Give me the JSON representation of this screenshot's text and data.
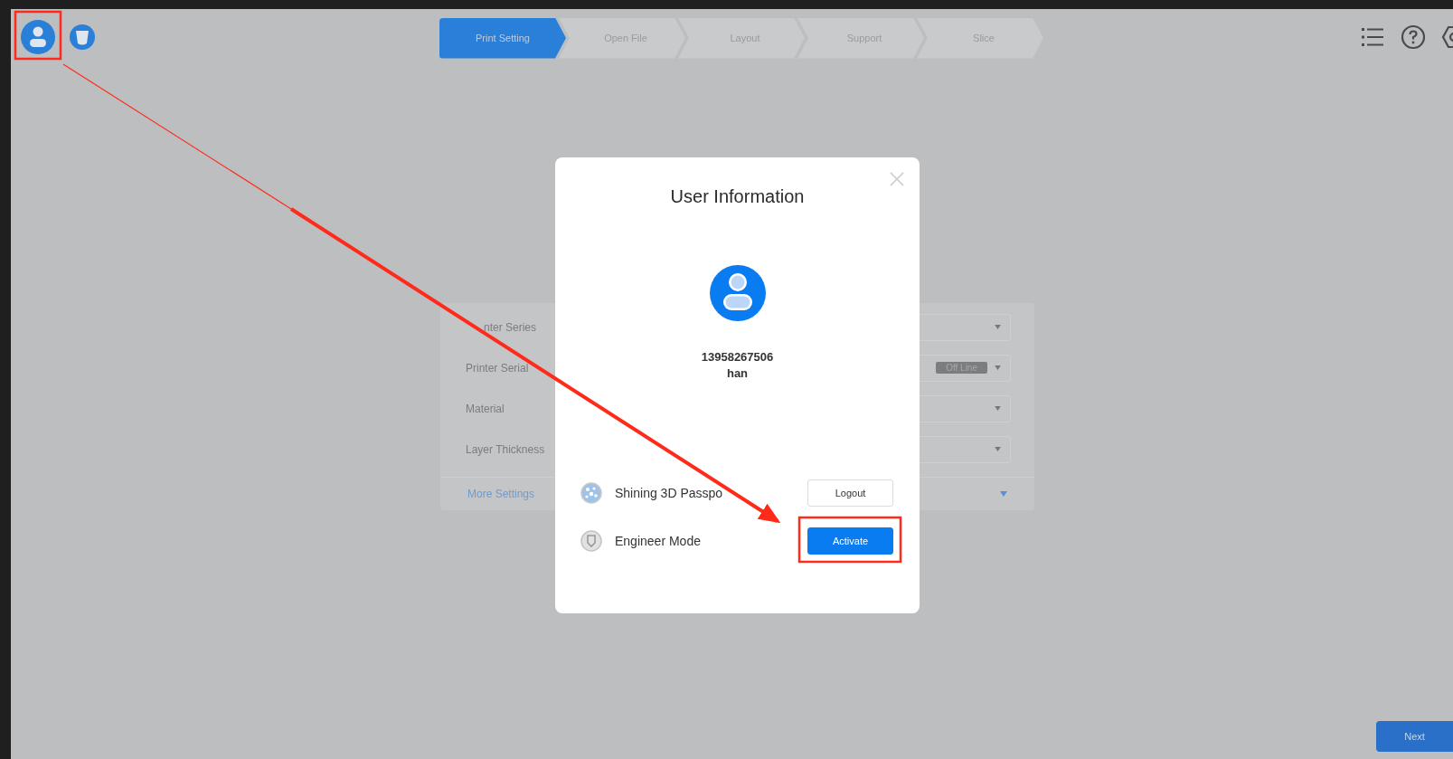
{
  "top_bar": {
    "steps": [
      {
        "label": "Print Setting",
        "selected": true
      },
      {
        "label": "Open File",
        "selected": false
      },
      {
        "label": "Layout",
        "selected": false
      },
      {
        "label": "Support",
        "selected": false
      },
      {
        "label": "Slice",
        "selected": false
      }
    ]
  },
  "settings_form": {
    "fields": [
      {
        "label": "nter Series"
      },
      {
        "label": "Printer Serial",
        "status": "Off Line"
      },
      {
        "label": "Material"
      },
      {
        "label": "Layer Thickness"
      }
    ],
    "more_settings": "More Settings"
  },
  "dialog": {
    "title": "User Information",
    "account": "13958267506",
    "name": "han",
    "rows": [
      {
        "kind": "passport",
        "label": "Shining 3D Passpo",
        "action": "Logout",
        "primary": false
      },
      {
        "kind": "engineer",
        "label": "Engineer Mode",
        "action": "Activate",
        "primary": true
      }
    ]
  },
  "next_button": "Next"
}
